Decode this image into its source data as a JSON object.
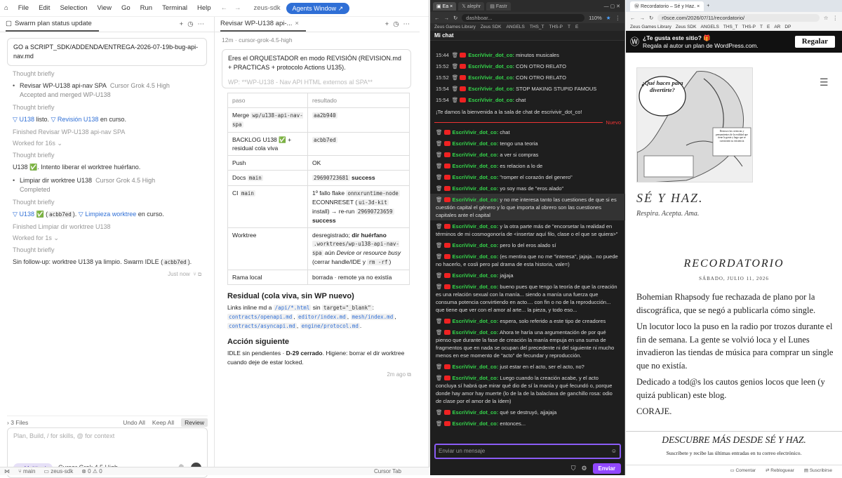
{
  "ide": {
    "menu": [
      "File",
      "Edit",
      "Selection",
      "View",
      "Go",
      "Run",
      "Terminal",
      "Help"
    ],
    "title": "zeus-sdk",
    "agents_window": "Agents Window",
    "chat_tab": "Swarm plan status update",
    "prompt": "GO a SCRIPT_SDK/ADDENDA/ENTREGA-2026-07-19b-bug-api-nav.md",
    "thought": "Thought briefly",
    "task1": {
      "title": "Revisar WP-U138 api-nav SPA",
      "model": "Cursor Grok 4.5 High",
      "sub": "Accepted and merged WP-U138"
    },
    "line1": {
      "pre": "U138",
      "mid": " listo. ",
      "link": "Revisión U138",
      "post": " en curso."
    },
    "finished1": "Finished Revisar WP-U138 api-nav SPA",
    "worked1": "Worked for 16s",
    "line2": "U138 ✅. Intento liberar el worktree huérfano.",
    "task2": {
      "title": "Limpiar dir worktree U138",
      "model": "Cursor Grok 4.5 High",
      "sub": "Completed"
    },
    "line3": {
      "pre": "U138",
      "mid": " ✅ (",
      "code": "acbb7ed",
      "mid2": "). ",
      "link": "Limpieza worktree",
      "post": " en curso."
    },
    "finished2": "Finished Limpiar dir worktree U138",
    "worked2": "Worked for 1s",
    "line4": {
      "pre": "Sin follow-up: worktree U138 ya limpio. Swarm IDLE (",
      "code": "acbb7ed",
      "post": ")."
    },
    "just_now": "Just now",
    "files": "3 Files",
    "undo_all": "Undo All",
    "keep_all": "Keep All",
    "review": "Review",
    "input_placeholder": "Plan, Build, / for skills, @ for context",
    "multitask": "Multitask",
    "model": "Cursor Grok 4.5 High",
    "status": {
      "branch": "main",
      "project": "zeus-sdk",
      "problems": "0",
      "warnings": "0",
      "tab": "Cursor Tab"
    }
  },
  "review": {
    "tab": "Revisar WP-U138 api-...",
    "model": "cursor-grok-4.5-high",
    "age": "12m",
    "prompt": "Eres el ORQUESTADOR en modo REVISIÓN (REVISION.md + PRACTICAS + protocolo Actions U135).",
    "prompt_cut": "WP: **WP-U138 - Nav API HTML externos al SPA**",
    "rows": [
      {
        "k": "paso",
        "v": "resultado"
      },
      {
        "k": "Merge",
        "kc": "wp/u138-api-nav-spa",
        "vc": "aa2b940"
      },
      {
        "k": "BACKLOG U138 ✅ + residual cola viva",
        "vc": "acbb7ed"
      },
      {
        "k": "Push",
        "v": "OK"
      },
      {
        "k": "Docs",
        "kc": "main",
        "vc": "29690723681",
        "vb": "success"
      },
      {
        "k": "CI",
        "kc": "main",
        "v": "1º fallo flake",
        "vc": "onnxruntime-node",
        "v2": "ECONNRESET (",
        "vc2": "ui-3d-kit",
        "v3": " install) → re-run ",
        "vc3": "29690723659",
        "vb": "success"
      },
      {
        "k": "Worktree",
        "v": "desregistrado; ",
        "vbb": "dir huérfano",
        "vc": ".worktrees/wp-u138-api-nav-spa",
        "v2": " aún ",
        "vi": "Device or resource busy",
        "v3": " (cerrar handle/IDE y ",
        "vc2": "rm -rf",
        "v4": ")"
      },
      {
        "k": "Rama local",
        "v": "borrada · remote ya no existía"
      }
    ],
    "h_residual": "Residual (cola viva, sin WP nuevo)",
    "residual": {
      "pre": "Links inline md a ",
      "c1": "/api/*.html",
      "mid": " sin ",
      "c2": "target=\"_blank\"",
      "mid2": ": ",
      "files": [
        "contracts/openapi.md",
        "editor/index.md",
        "mesh/index.md",
        "contracts/asyncapi.md",
        "engine/protocol.md"
      ]
    },
    "h_next": "Acción siguiente",
    "next": {
      "pre": "IDLE sin pendientes · ",
      "bold": "D-29 cerrado",
      "post": ". Higiene: borrar el dir worktree cuando deje de estar locked."
    },
    "age2": "2m ago"
  },
  "chat": {
    "tabs": [
      "Ea",
      "alephr",
      "Fastr"
    ],
    "url": "dashboar...",
    "zoom": "110%",
    "bookmarks": [
      "Zeus Games Library",
      "Zeus SDK",
      "ANGELS",
      "THS_T",
      "THS-P",
      "T",
      "E"
    ],
    "header": "Mi chat",
    "user": "EscriVivir_dot_co:",
    "top": [
      {
        "t": "15:44",
        "m": "minutos musicales"
      },
      {
        "t": "15:52",
        "m": "CON OTRO RELATO"
      },
      {
        "t": "15:52",
        "m": "CON OTRO RELATO"
      },
      {
        "t": "15:54",
        "m": "STOP MAKING STUPID FAMOUS"
      },
      {
        "t": "15:54",
        "m": "chat"
      }
    ],
    "welcome": "¡Te damos la bienvenida a la sala de chat de escrivivir_dot_co!",
    "nuevo": "Nuevo",
    "msgs": [
      "chat",
      "tengo una teoria",
      "a ver si compras",
      "es relacion a lo de",
      "\"romper el corazón del genero\"",
      "yo soy mas de \"eros alado\"",
      "y no me interesa tanto las cuestiones de que si es cuestión capital el género y lo que importa al obrero son las cuestiones capitales ante el capital",
      "y la otra parte más de \"encorsetar la realidad en términos de mi cosmogonoría de <insertar aquí filo, clase o el que se quiera>\"",
      "pero lo del eros alado sí",
      "(es mentira que no me \"interesa\", jajaja.. no puede no hacerlo, e cosli pero pal drama de esta historia, vale=)",
      "jajjaja",
      "bueno pues que tengo la teoría de que la creación es una relación sexual con la manía... siendo a manía una fuerza que consuma potencia convirtiendo en acto.... con fin o no de la reproducción... que tiene que ver con el amor al arte... la pieza, y todo eso...",
      "espera, solo referido a este tipo de creadores",
      "Ahora te haría una argumentación de por qué pienso que durante la fase de creación la manía empuja en una suma de fragmentos que en nada se ocupan del precedente ni del siguiente ni mucho menos en ese momento de \"acto\" de fecundar y reproducción.",
      "just estar en el acto, ser el acto, no?",
      "Luego cuando la creación acabe, y el acto concluya sí habrá que mirar qué dio de sí la manía y qué fecundó o, porque donde hay amor hay muerte (lo de la de la balaclava de ganchillo rosa: odio de clase por el amor de la ídem)",
      "qué se destruyó, ajjajaja",
      "entonces..."
    ],
    "input_placeholder": "Enviar un mensaje",
    "send": "Enviar"
  },
  "blog": {
    "tab": "Recordatorio – Sé y Haz.",
    "url": "r0sce.com/2026/07/11/recordatorio/",
    "bookmarks": [
      "Zeus Games Library",
      "Zeus SDK",
      "ANGELS",
      "THS_T",
      "THS-P",
      "T",
      "E",
      "AR",
      "DP"
    ],
    "banner_title": "¿Te gusta este sitio? 🎁",
    "banner_sub": "Regala al autor un plan de WordPress.com.",
    "regalar": "Regalar",
    "img_bubble": "¿Qué haces para divertirte?",
    "img_caption": "Destrozo las creencias y pensamientos de la realidad que tiene la gente y hago que se cuestionen su existencia",
    "site_title": "SÉ Y HAZ.",
    "tagline": "Respira. Acepta. Ama.",
    "post_title": "RECORDATORIO",
    "post_date": "SÁBADO, JULIO 11, 2026",
    "paras": [
      "Bohemian Rhapsody fue rechazada de plano por la discográfica, que se negó a publicarla cómo single.",
      "Un locutor loco la puso en la radio por trozos durante el fin de semana. La gente se volvió loca y el Lunes invadieron las tiendas de música para comprar un single que no existía.",
      "Dedicado a tod@s los cautos genios locos que leen (y quizá publican) este blog.",
      "CORAJE."
    ],
    "discover": "DESCUBRE MÁS DESDE SÉ Y HAZ.",
    "discover_sub": "Suscríbete y recibe las últimas entradas en tu correo electrónico.",
    "foot": [
      "Comentar",
      "Rebloguear",
      "Suscribirse"
    ]
  }
}
